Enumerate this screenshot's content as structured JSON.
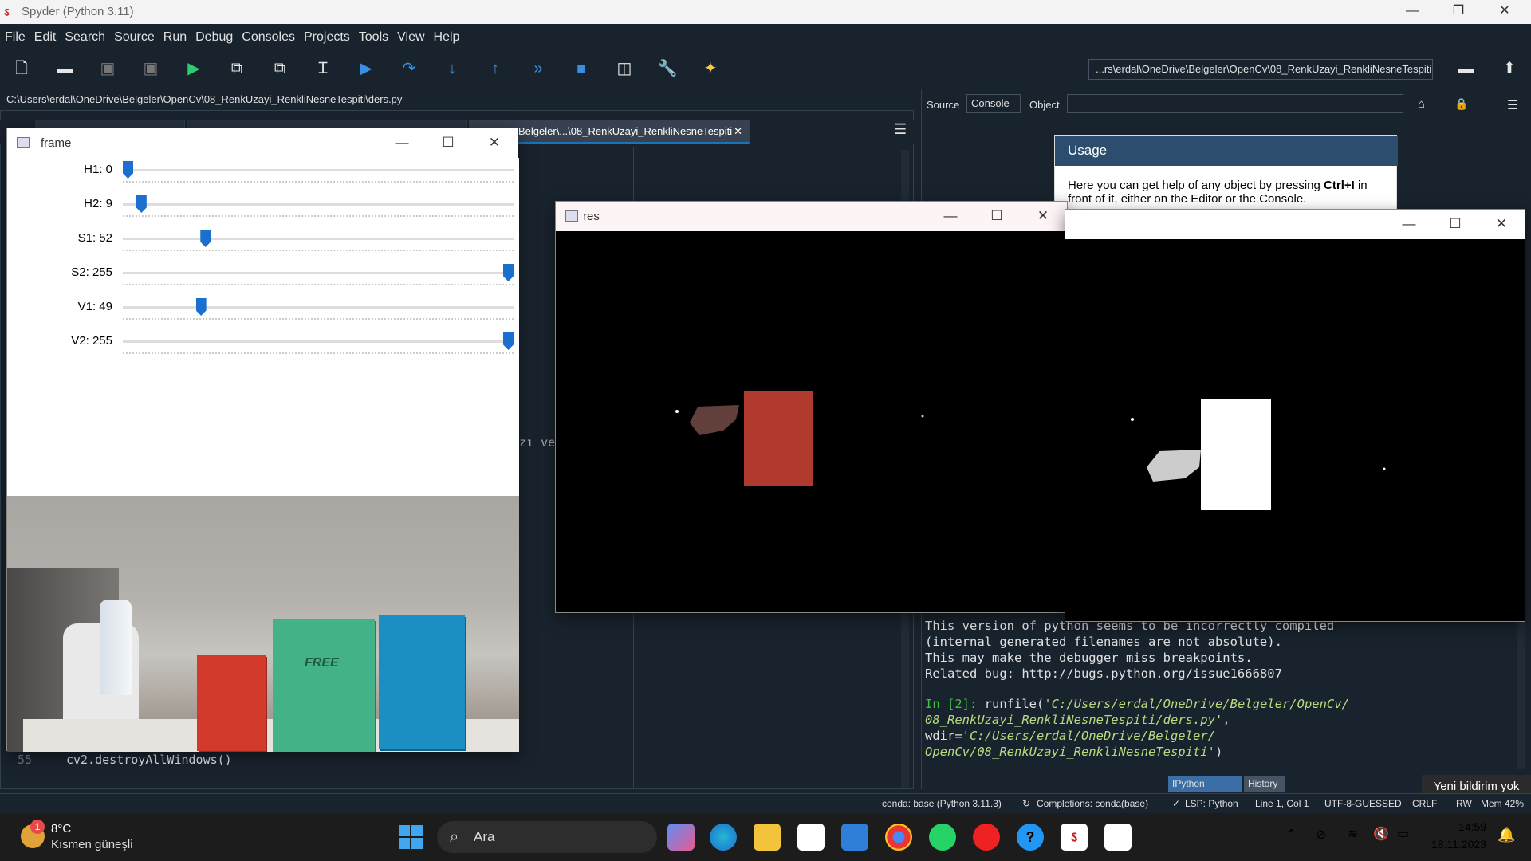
{
  "window": {
    "title": "Spyder (Python 3.11)"
  },
  "menu": [
    "File",
    "Edit",
    "Search",
    "Source",
    "Run",
    "Debug",
    "Consoles",
    "Projects",
    "Tools",
    "View",
    "Help"
  ],
  "toolbar": {
    "icons": [
      "new-file-icon",
      "open-file-icon",
      "save-icon",
      "save-all-icon",
      "run-icon",
      "run-cell-icon",
      "run-cell-advance-icon",
      "run-selection-icon",
      "debug-icon",
      "step-over-icon",
      "step-into-icon",
      "step-out-icon",
      "continue-icon",
      "stop-icon",
      "maximize-pane-icon",
      "preferences-icon",
      "python-path-icon"
    ],
    "working_dir": "...rs\\erdal\\OneDrive\\Belgeler\\OpenCv\\08_RenkUzayi_RenkliNesneTespiti"
  },
  "editor": {
    "path": "C:\\Users\\erdal\\OneDrive\\Belgeler\\OpenCv\\08_RenkUzayi_RenkliNesneTespiti\\ders.py",
    "active_tab": "Belgeler\\...\\08_RenkUzayi_RenkliNesneTespiti",
    "line_number": "55",
    "line_code": "cv2.destroyAllWindows()",
    "fragment": "zı ve"
  },
  "help": {
    "source_label": "Source",
    "source_value": "Console",
    "object_label": "Object",
    "object_value": "",
    "usage_title": "Usage",
    "usage_text_1": "Here you can get help of any object by pressing ",
    "usage_shortcut": "Ctrl+I",
    "usage_text_2": " in front of it, either on the Editor or the Console."
  },
  "console": {
    "lines": [
      "This version of python seems to be incorrectly compiled",
      "(internal generated filenames are not absolute).",
      "This may make the debugger miss breakpoints.",
      "Related bug: http://bugs.python.org/issue1666807"
    ],
    "prompt": "In [2]:",
    "cmd_start": " runfile(",
    "arg1_a": "'C:/Users/erdal/OneDrive/Belgeler/OpenCv/",
    "arg1_b": "08_RenkUzayi_RenkliNesneTespiti/ders.py'",
    "mid": ", wdir=",
    "arg2_a": "'C:/Users/erdal/OneDrive/Belgeler/",
    "arg2_b": "OpenCv/08_RenkUzayi_RenkliNesneTespiti'",
    "cmd_end": ")"
  },
  "bottom_tabs": [
    "IPython Console",
    "History"
  ],
  "notification": "Yeni bildirim yok",
  "status": {
    "env": "conda: base (Python 3.11.3)",
    "completions": "Completions: conda(base)",
    "lsp": "LSP: Python",
    "pos": "Line 1, Col 1",
    "enc": "UTF-8-GUESSED",
    "eol": "CRLF",
    "rw": "RW",
    "mem": "Mem 42%"
  },
  "frame_window": {
    "title": "frame",
    "trackbars": [
      {
        "label": "H1: 0",
        "value": 0
      },
      {
        "label": "H2: 9",
        "value": 9
      },
      {
        "label": "S1: 52",
        "value": 52
      },
      {
        "label": "S2: 255",
        "value": 255
      },
      {
        "label": "V1: 49",
        "value": 49
      },
      {
        "label": "V2: 255",
        "value": 255
      }
    ],
    "trackbar_max": 255,
    "book_label": "FREE"
  },
  "res_window": {
    "title": "res"
  },
  "taskbar": {
    "weather_temp": "8°C",
    "weather_desc": "Kısmen güneşli",
    "weather_badge": "1",
    "search_placeholder": "Ara",
    "apps": [
      "copilot-icon",
      "edge-icon",
      "file-explorer-icon",
      "store-icon",
      "mail-icon",
      "chrome-icon",
      "whatsapp-icon",
      "youtube-icon",
      "help-icon",
      "spyder-icon",
      "notepad-icon"
    ],
    "time": "14:59",
    "date": "18.11.2023"
  },
  "colors": {
    "accent": "#1a72bb",
    "panel": "#19232d",
    "taskbar": "#1c1c1c"
  }
}
